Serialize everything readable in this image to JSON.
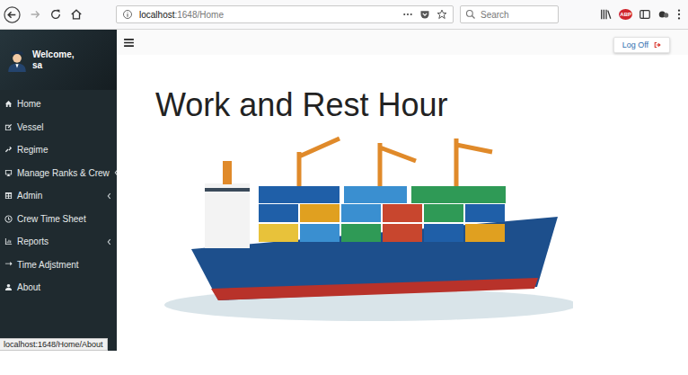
{
  "browser": {
    "url_host": "localhost",
    "url_path": ":1648/Home",
    "search": {
      "placeholder": "Search"
    },
    "extension_badge": "ABP"
  },
  "sidebar": {
    "greeting": "Welcome,",
    "user": "sa",
    "items": [
      {
        "label": "Home",
        "has_submenu": false
      },
      {
        "label": "Vessel",
        "has_submenu": false
      },
      {
        "label": "Regime",
        "has_submenu": false
      },
      {
        "label": "Manage Ranks & Crew",
        "has_submenu": true
      },
      {
        "label": "Admin",
        "has_submenu": true
      },
      {
        "label": "Crew Time Sheet",
        "has_submenu": false
      },
      {
        "label": "Reports",
        "has_submenu": true
      },
      {
        "label": "Time Adjstment",
        "has_submenu": false
      },
      {
        "label": "About",
        "has_submenu": false
      }
    ]
  },
  "topbar": {
    "log_off": "Log Off"
  },
  "main": {
    "title": "Work and Rest Hour"
  },
  "status_bar": {
    "url": "localhost:1648/Home/About"
  }
}
